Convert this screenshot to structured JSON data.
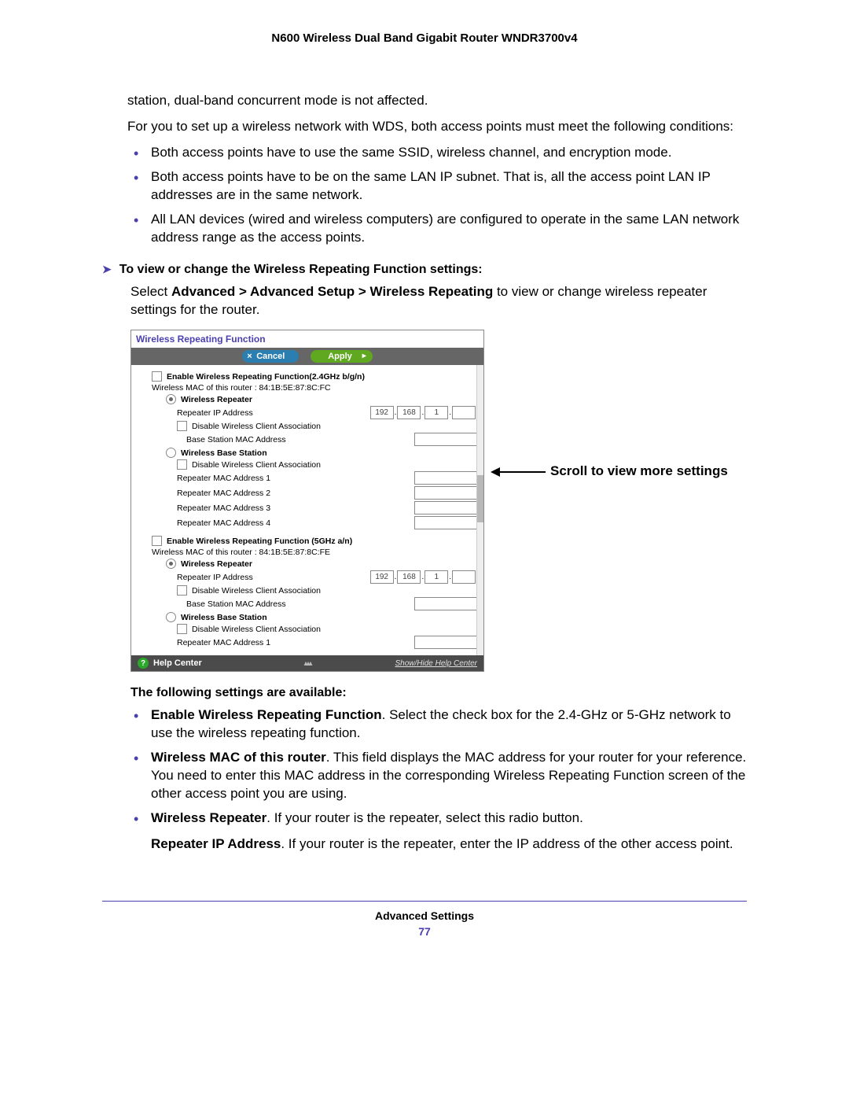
{
  "header": "N600 Wireless Dual Band Gigabit Router WNDR3700v4",
  "intro_para1": "station, dual-band concurrent mode is not affected.",
  "intro_para2": "For you to set up a wireless network with WDS, both access points must meet the following conditions:",
  "cond": [
    "Both access points have to use the same SSID, wireless channel, and encryption mode.",
    "Both access points have to be on the same LAN IP subnet. That is, all the access point LAN IP addresses are in the same network.",
    "All LAN devices (wired and wireless computers) are configured to operate in the same LAN network address range as the access points."
  ],
  "task_heading": "To view or change the Wireless Repeating Function settings:",
  "task_line_pre": "Select ",
  "task_line_bold": "Advanced > Advanced Setup > Wireless Repeating",
  "task_line_post": " to view or change wireless repeater settings for the router.",
  "panel": {
    "title": "Wireless Repeating Function",
    "cancel": "Cancel",
    "apply": "Apply",
    "enable24": "Enable Wireless Repeating Function(2.4GHz b/g/n)",
    "mac24": "Wireless MAC of this router : 84:1B:5E:87:8C:FC",
    "repeater": "Wireless Repeater",
    "repeater_ip": "Repeater IP Address",
    "ip": [
      "192",
      "168",
      "1",
      ""
    ],
    "disable_assoc": "Disable Wireless Client Association",
    "base_mac": "Base Station MAC Address",
    "base_station": "Wireless Base Station",
    "rmac1": "Repeater MAC Address 1",
    "rmac2": "Repeater MAC Address 2",
    "rmac3": "Repeater MAC Address 3",
    "rmac4": "Repeater MAC Address 4",
    "enable5": "Enable Wireless Repeating Function (5GHz a/n)",
    "mac5": "Wireless MAC of this router : 84:1B:5E:87:8C:FE",
    "help_center": "Help Center",
    "show_hide": "Show/Hide Help Center"
  },
  "annotation": "Scroll to view more settings",
  "avail_heading": "The following settings are available:",
  "avail": [
    {
      "b": "Enable Wireless Repeating Function",
      "t": ". Select the check box for the 2.4-GHz or 5-GHz network to use the wireless repeating function."
    },
    {
      "b": "Wireless MAC of this router",
      "t": ". This field displays the MAC address for your router for your reference. You need to enter this MAC address in the corresponding Wireless Repeating Function screen of the other access point you are using."
    },
    {
      "b": "Wireless Repeater",
      "t": ". If your router is the repeater, select this radio button."
    }
  ],
  "repeater_ip_para_b": "Repeater IP Address",
  "repeater_ip_para_t": ". If your router is the repeater, enter the IP address of the other access point.",
  "footer_label": "Advanced Settings",
  "page_number": "77"
}
